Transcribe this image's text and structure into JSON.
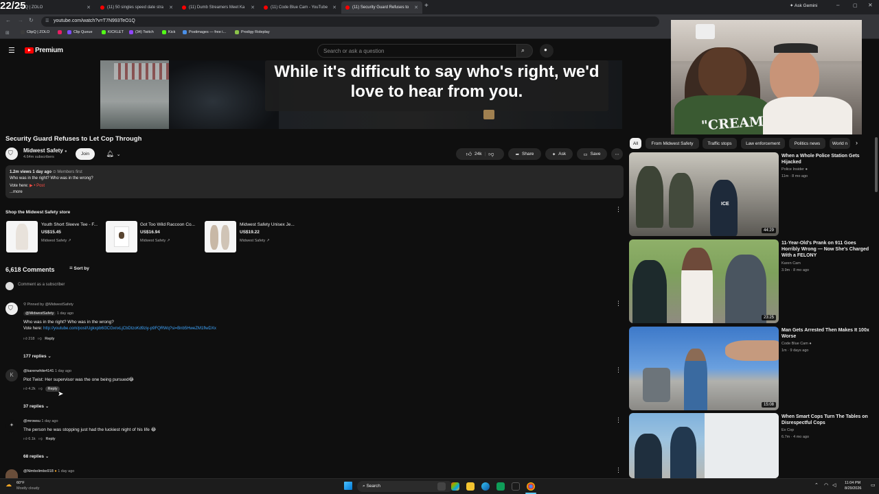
{
  "overlay_counter": "22/25",
  "tabs": [
    {
      "label": "ClipQ | ZOLO"
    },
    {
      "label": "(11) 50 singles speed date stra"
    },
    {
      "label": "(11) Dumb Streamers Meet Ka"
    },
    {
      "label": "(11) Code Blue Cam - YouTube"
    },
    {
      "label": "(11) Security Guard Refuses to"
    }
  ],
  "ask_gemini": "Ask Gemini",
  "url": "youtube.com/watch?v=T7N993TeO1Q",
  "bookmarks": [
    "ClipQ | ZOLO",
    "Clip Queue",
    "KICKLET",
    "(34) Twitch",
    "Kick",
    "Postimages — free i...",
    "Prodigy Roleplay"
  ],
  "yt": {
    "logo": "Premium",
    "search_placeholder": "Search or ask a question"
  },
  "video": {
    "caption": "While it's difficult to say who's right, we'd love to hear from you."
  },
  "webcam_shirt_text": "\"CREAM\"",
  "title": "Security Guard Refuses to Let Cop Through",
  "channel": {
    "name": "Midwest Safety",
    "subs": "4.64m subscribers",
    "join": "Join"
  },
  "actions": {
    "likes": "24k",
    "share": "Share",
    "ask": "Ask",
    "save": "Save"
  },
  "description": {
    "meta": "1.2m views  1 day ago",
    "members": "Members first",
    "line1": "Who was in the right? Who was in the wrong?",
    "line2_prefix": "Vote here:",
    "post": "• Post",
    "more": "...more"
  },
  "store": {
    "heading": "Shop the Midwest Safety store",
    "products": [
      {
        "name": "Youth Short Sleeve Tee - F...",
        "price": "US$15.45",
        "seller": "Midwest Safety"
      },
      {
        "name": "Got Too Wild Raccoon Co...",
        "price": "US$16.94",
        "seller": "Midwest Safety"
      },
      {
        "name": "Midwest Safety Unisex Je...",
        "price": "US$19.22",
        "seller": "Midwest Safety"
      }
    ]
  },
  "comments": {
    "count": "6,618 Comments",
    "sort": "Sort by",
    "add_placeholder": "Comment as a subscriber",
    "items": [
      {
        "pinned": "Pinned by @MidwestSafety",
        "author": "@MidwestSafety",
        "time": "1 day ago",
        "text": "Who was in the right? Who was in the wrong?",
        "text2_prefix": "Vote here:",
        "link": "http://youtube.com/post/Ugkxpb6I3CGxnxLjCbDtzoKd9ziy-p9FQRWq?si=Bnb5HweZM1flwDXx",
        "likes": "218",
        "reply": "Reply",
        "replies": "177 replies"
      },
      {
        "author": "@karenwhite4141",
        "time": "1 day ago",
        "text": "Plot Twist:  Her supervisor was the one being pursued😂",
        "likes": "4.2k",
        "reply": "Reply",
        "replies": "37 replies"
      },
      {
        "author": "@mrowsu",
        "time": "1 day ago",
        "text": "The person he was stopping just had the luckiest night of his life 😂",
        "likes": "6.1k",
        "reply": "Reply",
        "replies": "68 replies"
      },
      {
        "author": "@Nimbolimbo918",
        "time": "1 day ago"
      }
    ]
  },
  "chips": [
    "All",
    "From Midwest Safety",
    "Traffic stops",
    "Law enforcement",
    "Politics news",
    "World n"
  ],
  "related": [
    {
      "title": "When a Whole Police Station Gets Hijacked",
      "channel": "Police Insider",
      "meta": "11m · 8 mo ago",
      "duration": "44:29"
    },
    {
      "title": "11-Year-Old's Prank on 911 Goes Horribly Wrong — Now She's Charged With a FELONY",
      "channel": "Karen Cam",
      "meta": "3.9m · 8 mo ago",
      "duration": "23:25"
    },
    {
      "title": "Man Gets Arrested Then Makes It 100x Worse",
      "channel": "Code Blue Cam",
      "meta": "1m · 9 days ago",
      "duration": "15:08"
    },
    {
      "title": "When Smart Cops Turn The Tables on Disrespectful Cops",
      "channel": "Ex Cop",
      "meta": "6.7m · 4 mo ago",
      "duration": ""
    }
  ],
  "taskbar": {
    "weather_temp": "60°F",
    "weather_desc": "Mostly cloudy",
    "search": "Search",
    "time": "11:04 PM",
    "date": "8/29/2026"
  }
}
